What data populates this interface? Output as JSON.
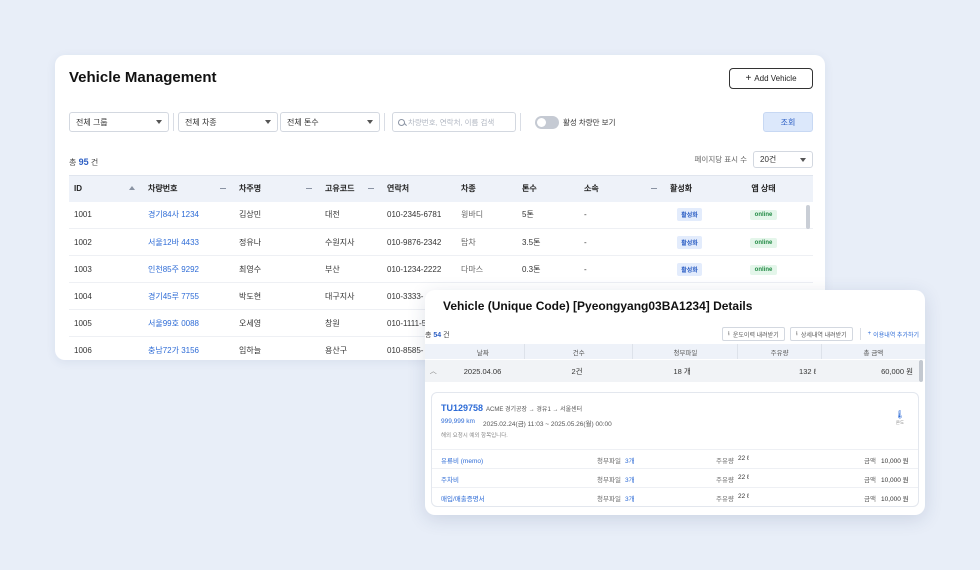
{
  "main": {
    "title": "Vehicle Management",
    "add_button": "Add Vehicle",
    "filters": {
      "group": "전체 그룹",
      "car_type": "전체 차종",
      "tonnage": "전체 톤수",
      "search_placeholder": "차량번호, 연락처, 이름 검색",
      "active_only_label": "활성 차량만 보기",
      "query_button": "조회"
    },
    "total_prefix": "총",
    "total_count": "95",
    "total_suffix": "건",
    "per_page_label": "페이지당 표시 수",
    "per_page_value": "20건",
    "columns": [
      "ID",
      "차량번호",
      "차주명",
      "고유코드",
      "연락처",
      "차종",
      "톤수",
      "소속",
      "활성화",
      "앱 상태"
    ],
    "rows": [
      {
        "id": "1001",
        "plate": "경기84사 1234",
        "owner": "김상민",
        "code": "대전",
        "phone": "010-2345-6781",
        "type": "윙바디",
        "ton": "5톤",
        "affil": "-",
        "active": "활성화",
        "app": "online"
      },
      {
        "id": "1002",
        "plate": "서울12바 4433",
        "owner": "정유나",
        "code": "수원지사",
        "phone": "010-9876-2342",
        "type": "탑차",
        "ton": "3.5톤",
        "affil": "-",
        "active": "활성화",
        "app": "online"
      },
      {
        "id": "1003",
        "plate": "인천85주 9292",
        "owner": "최영수",
        "code": "부산",
        "phone": "010-1234-2222",
        "type": "다마스",
        "ton": "0.3톤",
        "affil": "-",
        "active": "활성화",
        "app": "online"
      },
      {
        "id": "1004",
        "plate": "경기45루 7755",
        "owner": "박도현",
        "code": "대구지사",
        "phone": "010-3333-",
        "type": "",
        "ton": "",
        "affil": "",
        "active": "",
        "app": ""
      },
      {
        "id": "1005",
        "plate": "서울99호 0088",
        "owner": "오세영",
        "code": "창원",
        "phone": "010-1111-5",
        "type": "",
        "ton": "",
        "affil": "",
        "active": "",
        "app": ""
      },
      {
        "id": "1006",
        "plate": "충남72가 3156",
        "owner": "임하늘",
        "code": "용산구",
        "phone": "010-8585-",
        "type": "",
        "ton": "",
        "affil": "",
        "active": "",
        "app": ""
      }
    ]
  },
  "detail": {
    "title": "Vehicle (Unique Code) [Pyeongyang03BA1234] Details",
    "total_prefix": "총",
    "total_count": "54",
    "total_suffix": "건",
    "btn_fuel": "운도이력 내려받기",
    "btn_detail": "상세내역 내려받기",
    "link_add": "이용내역 추가하기",
    "columns": [
      "날짜",
      "건수",
      "청부파일",
      "주유량",
      "총 금액"
    ],
    "summary": {
      "date": "2025.04.06",
      "count": "2건",
      "files": "18 개",
      "fuel": "132 ℓ",
      "amount": "60,000 원"
    },
    "trip": {
      "code": "TU129758",
      "route": "ACME 경기공장 → 경유1 → 서울센터",
      "km": "999,999 km",
      "date": "2025.02.24(금) 11:03 ~ 2025.05.26(월) 00:00",
      "note": "해외 요청시 예외 항목입니다.",
      "temp_label": "온도"
    },
    "items": [
      {
        "name": "유류비 (memo)",
        "file_label": "청부파일",
        "file_value": "3개",
        "fuel_label": "주유량",
        "fuel_value": "22 ℓ",
        "amount_label": "금액",
        "amount_value": "10,000 원"
      },
      {
        "name": "주차비",
        "file_label": "청부파일",
        "file_value": "3개",
        "fuel_label": "주유량",
        "fuel_value": "22 ℓ",
        "amount_label": "금액",
        "amount_value": "10,000 원"
      },
      {
        "name": "매입/매출증명서",
        "file_label": "청부파일",
        "file_value": "3개",
        "fuel_label": "주유량",
        "fuel_value": "22 ℓ",
        "amount_label": "금액",
        "amount_value": "10,000 원"
      }
    ]
  },
  "colors": {
    "accent": "#2d6bd6",
    "online": "#228b45",
    "background": "#e8eef8"
  }
}
